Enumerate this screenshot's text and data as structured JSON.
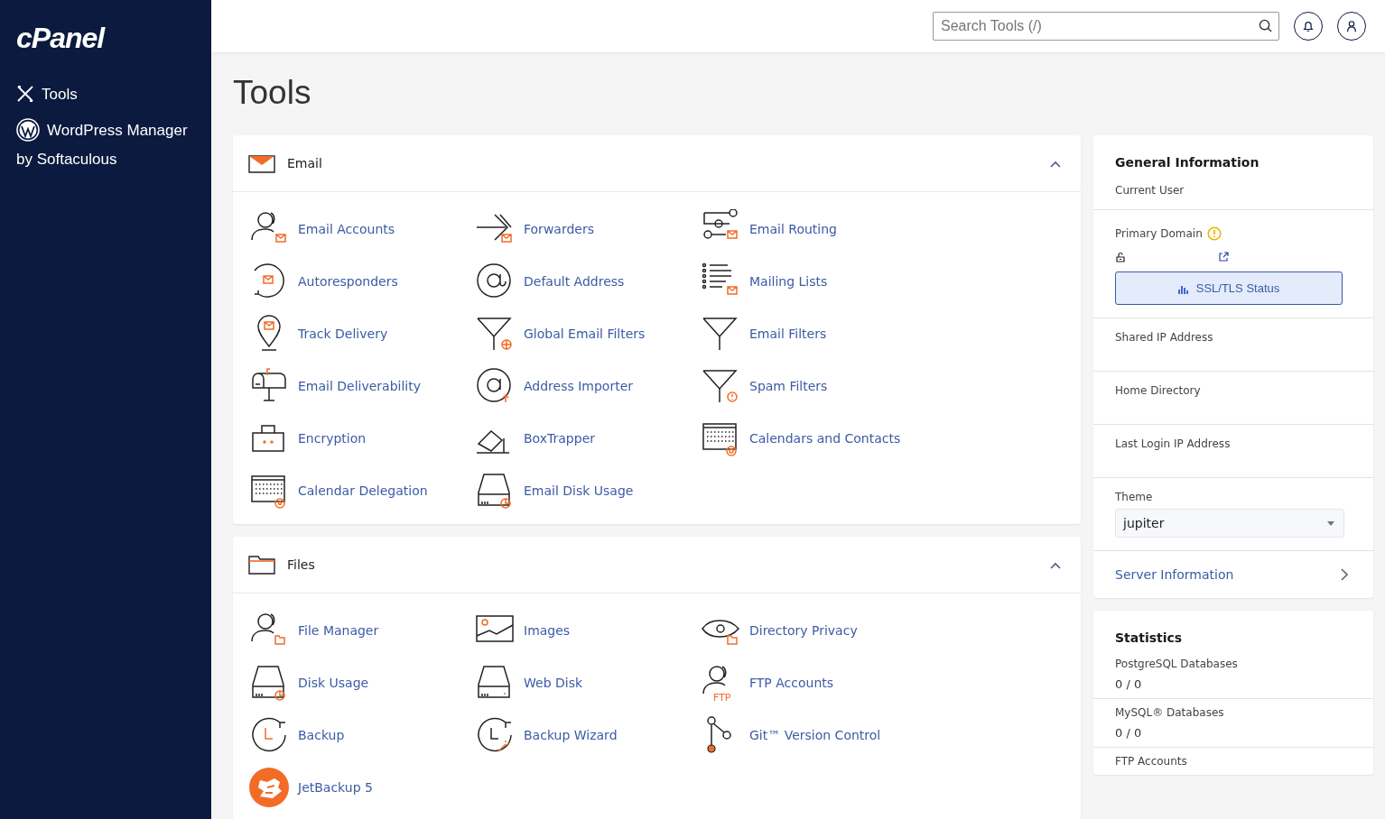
{
  "logo": "cPanel",
  "sidebar": {
    "items": [
      {
        "label": "Tools",
        "kind": "tools"
      },
      {
        "label": "WordPress Manager by Softaculous",
        "kind": "wordpress"
      }
    ]
  },
  "search": {
    "placeholder": "Search Tools (/)"
  },
  "page_title": "Tools",
  "sections": [
    {
      "title": "Email",
      "kind": "mail",
      "expanded": true,
      "tools": [
        {
          "label": "Email Accounts",
          "kind": "user-mail"
        },
        {
          "label": "Forwarders",
          "kind": "forward"
        },
        {
          "label": "Email Routing",
          "kind": "routing"
        },
        {
          "label": "Autoresponders",
          "kind": "circle-mail"
        },
        {
          "label": "Default Address",
          "kind": "at"
        },
        {
          "label": "Mailing Lists",
          "kind": "list"
        },
        {
          "label": "Track Delivery",
          "kind": "pin"
        },
        {
          "label": "Global Email Filters",
          "kind": "funnel-globe"
        },
        {
          "label": "Email Filters",
          "kind": "funnel"
        },
        {
          "label": "Email Deliverability",
          "kind": "mailbox"
        },
        {
          "label": "Address Importer",
          "kind": "at-up"
        },
        {
          "label": "Spam Filters",
          "kind": "funnel-alert"
        },
        {
          "label": "Encryption",
          "kind": "lockbox"
        },
        {
          "label": "BoxTrapper",
          "kind": "trap"
        },
        {
          "label": "Calendars and Contacts",
          "kind": "cal-at"
        },
        {
          "label": "Calendar Delegation",
          "kind": "cal-gear"
        },
        {
          "label": "Email Disk Usage",
          "kind": "disk-pie"
        }
      ]
    },
    {
      "title": "Files",
      "kind": "folder",
      "expanded": true,
      "tools": [
        {
          "label": "File Manager",
          "kind": "user-folder"
        },
        {
          "label": "Images",
          "kind": "image"
        },
        {
          "label": "Directory Privacy",
          "kind": "eye"
        },
        {
          "label": "Disk Usage",
          "kind": "disk-pie"
        },
        {
          "label": "Web Disk",
          "kind": "disk"
        },
        {
          "label": "FTP Accounts",
          "kind": "user-ftp",
          "badge": "FTP"
        },
        {
          "label": "Backup",
          "kind": "clock"
        },
        {
          "label": "Backup Wizard",
          "kind": "clock-wand"
        },
        {
          "label": "Git™ Version Control",
          "kind": "git"
        },
        {
          "label": "JetBackup 5",
          "kind": "jet"
        }
      ]
    }
  ],
  "general_info": {
    "title": "General Information",
    "current_user": "Current User",
    "primary_domain": {
      "label": "Primary Domain",
      "warning": true,
      "button": "SSL/TLS Status"
    },
    "shared_ip": "Shared IP Address",
    "home_directory": "Home Directory",
    "last_login_ip": "Last Login IP Address",
    "theme": {
      "label": "Theme",
      "value": "jupiter"
    },
    "server_information": "Server Information"
  },
  "statistics": {
    "title": "Statistics",
    "items": [
      {
        "label": "PostgreSQL Databases",
        "value": "0 / 0"
      },
      {
        "label": "MySQL® Databases",
        "value": "0 / 0"
      },
      {
        "label": "FTP Accounts"
      }
    ]
  }
}
